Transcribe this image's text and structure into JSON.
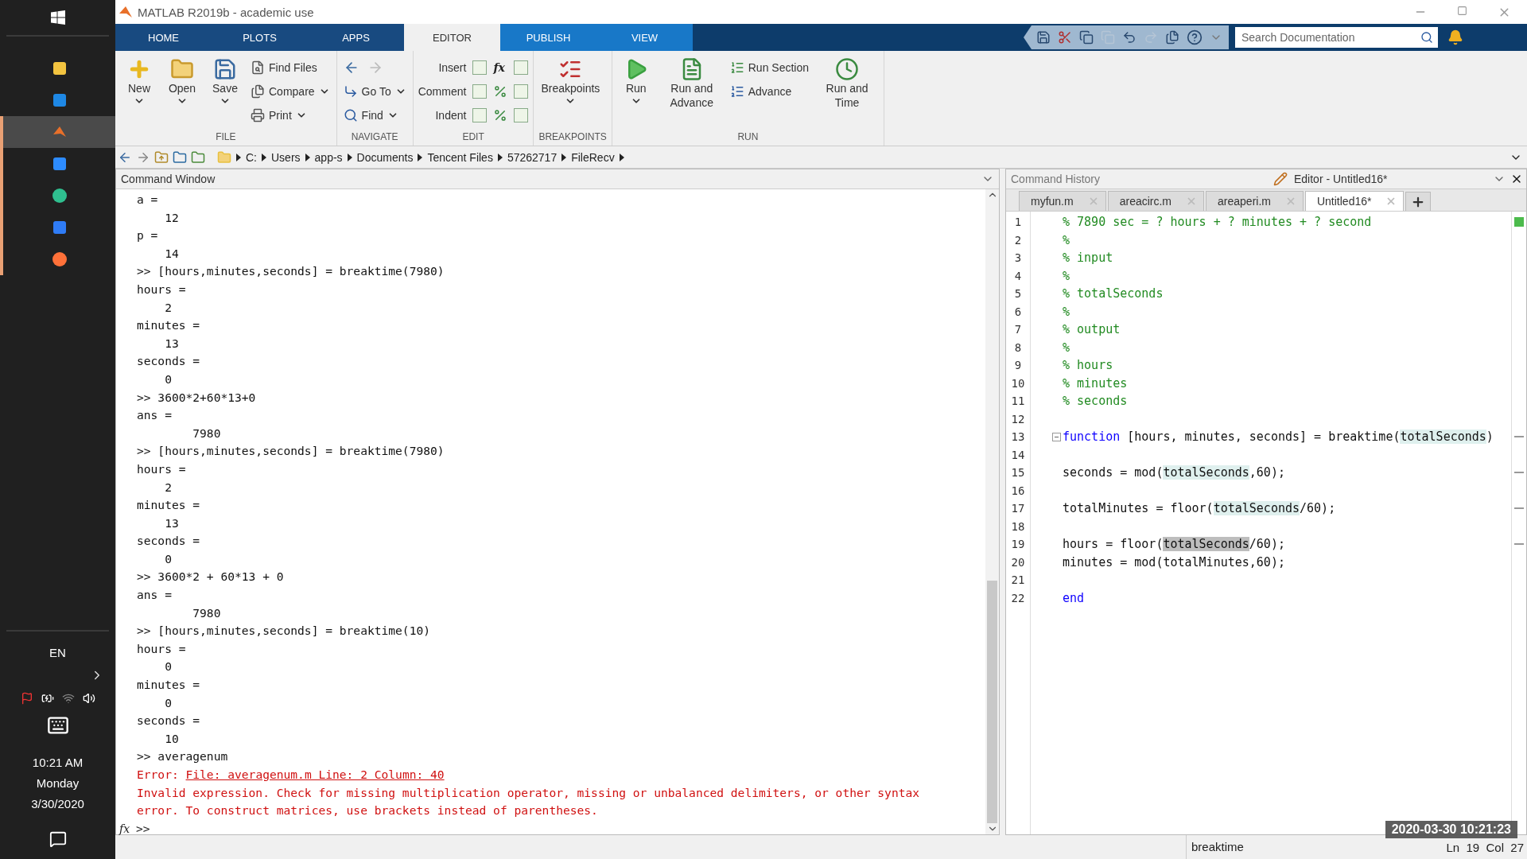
{
  "window": {
    "title": "MATLAB R2019b - academic use"
  },
  "taskbar": {
    "apps": [
      {
        "running": false,
        "selected": false
      },
      {
        "running": false,
        "selected": false
      },
      {
        "running": true,
        "selected": true
      },
      {
        "running": true,
        "selected": false
      },
      {
        "running": true,
        "selected": false
      },
      {
        "running": true,
        "selected": false
      },
      {
        "running": true,
        "selected": false
      }
    ],
    "language": "EN",
    "time": "10:21 AM",
    "day": "Monday",
    "date": "3/30/2020"
  },
  "ribbon_tabs": [
    {
      "label": "HOME",
      "selected": false,
      "kind": "global"
    },
    {
      "label": "PLOTS",
      "selected": false,
      "kind": "global"
    },
    {
      "label": "APPS",
      "selected": false,
      "kind": "global"
    },
    {
      "label": "EDITOR",
      "selected": true,
      "kind": "contextual"
    },
    {
      "label": "PUBLISH",
      "selected": false,
      "kind": "contextual"
    },
    {
      "label": "VIEW",
      "selected": false,
      "kind": "contextual"
    }
  ],
  "search": {
    "placeholder": "Search Documentation"
  },
  "ribbon_groups": [
    {
      "label": "FILE",
      "items": [
        {
          "kind": "big",
          "label": "New",
          "dropdown": true
        },
        {
          "kind": "big",
          "label": "Open",
          "dropdown": true
        },
        {
          "kind": "big",
          "label": "Save",
          "dropdown": true
        },
        {
          "kind": "small",
          "label": "Find Files",
          "dropdown": false
        },
        {
          "kind": "small",
          "label": "Compare",
          "dropdown": true
        },
        {
          "kind": "small",
          "label": "Print",
          "dropdown": true
        }
      ]
    },
    {
      "label": "NAVIGATE",
      "items": [
        {
          "kind": "nav"
        },
        {
          "kind": "small",
          "label": "Go To",
          "dropdown": true
        },
        {
          "kind": "small",
          "label": "Find",
          "dropdown": true
        }
      ]
    },
    {
      "label": "EDIT",
      "items": [
        {
          "kind": "tool_row",
          "label": "Insert",
          "glyph": "fx"
        },
        {
          "kind": "tool_row",
          "label": "Comment"
        },
        {
          "kind": "tool_row",
          "label": "Indent"
        }
      ]
    },
    {
      "label": "BREAKPOINTS",
      "items": [
        {
          "kind": "big",
          "label": "Breakpoints",
          "dropdown": true
        }
      ]
    },
    {
      "label": "RUN",
      "items": [
        {
          "kind": "big",
          "label": "Run",
          "dropdown": true
        },
        {
          "kind": "big",
          "label": "Run and Advance",
          "dropdown": false
        },
        {
          "kind": "small",
          "label": "Run Section",
          "dropdown": false
        },
        {
          "kind": "small",
          "label": "Advance",
          "dropdown": false
        },
        {
          "kind": "big",
          "label": "Run and Time",
          "dropdown": false
        }
      ]
    }
  ],
  "address_path": [
    "C:",
    "Users",
    "app-s",
    "Documents",
    "Tencent Files",
    "57262717",
    "FileRecv"
  ],
  "command_window": {
    "title": "Command Window",
    "lines": [
      {
        "kind": "output",
        "text": "a ="
      },
      {
        "kind": "output",
        "text": "    12"
      },
      {
        "kind": "output",
        "text": "p ="
      },
      {
        "kind": "output",
        "text": "    14"
      },
      {
        "kind": "output",
        "text": ">> [hours,minutes,seconds] = breaktime(7980)"
      },
      {
        "kind": "output",
        "text": "hours ="
      },
      {
        "kind": "output",
        "text": "    2"
      },
      {
        "kind": "output",
        "text": "minutes ="
      },
      {
        "kind": "output",
        "text": "    13"
      },
      {
        "kind": "output",
        "text": "seconds ="
      },
      {
        "kind": "output",
        "text": "    0"
      },
      {
        "kind": "output",
        "text": ">> 3600*2+60*13+0"
      },
      {
        "kind": "output",
        "text": "ans ="
      },
      {
        "kind": "output",
        "text": "        7980"
      },
      {
        "kind": "output",
        "text": ">> [hours,minutes,seconds] = breaktime(7980)"
      },
      {
        "kind": "output",
        "text": "hours ="
      },
      {
        "kind": "output",
        "text": "    2"
      },
      {
        "kind": "output",
        "text": "minutes ="
      },
      {
        "kind": "output",
        "text": "    13"
      },
      {
        "kind": "output",
        "text": "seconds ="
      },
      {
        "kind": "output",
        "text": "    0"
      },
      {
        "kind": "output",
        "text": ">> 3600*2 + 60*13 + 0"
      },
      {
        "kind": "output",
        "text": "ans ="
      },
      {
        "kind": "output",
        "text": "        7980"
      },
      {
        "kind": "output",
        "text": ">> [hours,minutes,seconds] = breaktime(10)"
      },
      {
        "kind": "output",
        "text": "hours ="
      },
      {
        "kind": "output",
        "text": "    0"
      },
      {
        "kind": "output",
        "text": "minutes ="
      },
      {
        "kind": "output",
        "text": "    0"
      },
      {
        "kind": "output",
        "text": "seconds ="
      },
      {
        "kind": "output",
        "text": "    10"
      },
      {
        "kind": "output",
        "text": ">> averagenum"
      },
      {
        "kind": "error_link",
        "text": "Error: ",
        "link": "File: averagenum.m Line: 2 Column: 40"
      },
      {
        "kind": "error",
        "text": "Invalid expression. Check for missing multiplication operator, missing or unbalanced delimiters, or other syntax"
      },
      {
        "kind": "error",
        "text": "error. To construct matrices, use brackets instead of parentheses."
      }
    ],
    "prompt_icon": "fx",
    "prompt": ">>"
  },
  "command_history": {
    "title": "Command History"
  },
  "editor": {
    "title": "Editor - Untitled16*",
    "tabs": [
      {
        "label": "myfun.m",
        "selected": false
      },
      {
        "label": "areacirc.m",
        "selected": false
      },
      {
        "label": "areaperi.m",
        "selected": false
      },
      {
        "label": "Untitled16*",
        "selected": true
      }
    ],
    "lines": [
      {
        "number": "1",
        "segments": [
          {
            "kind": "comment",
            "text": "% 7890 sec = ? hours + ? minutes + ? second"
          }
        ]
      },
      {
        "number": "2",
        "segments": [
          {
            "kind": "comment",
            "text": "%"
          }
        ]
      },
      {
        "number": "3",
        "segments": [
          {
            "kind": "comment",
            "text": "% input"
          }
        ]
      },
      {
        "number": "4",
        "segments": [
          {
            "kind": "comment",
            "text": "%"
          }
        ]
      },
      {
        "number": "5",
        "segments": [
          {
            "kind": "comment",
            "text": "% totalSeconds"
          }
        ]
      },
      {
        "number": "6",
        "segments": [
          {
            "kind": "comment",
            "text": "%"
          }
        ]
      },
      {
        "number": "7",
        "segments": [
          {
            "kind": "comment",
            "text": "% output"
          }
        ]
      },
      {
        "number": "8",
        "segments": [
          {
            "kind": "comment",
            "text": "%"
          }
        ]
      },
      {
        "number": "9",
        "segments": [
          {
            "kind": "comment",
            "text": "% hours"
          }
        ]
      },
      {
        "number": "10",
        "segments": [
          {
            "kind": "comment",
            "text": "% minutes"
          }
        ]
      },
      {
        "number": "11",
        "segments": [
          {
            "kind": "comment",
            "text": "% seconds"
          }
        ]
      },
      {
        "number": "12"
      },
      {
        "number": "13",
        "fold": true,
        "segments": [
          {
            "kind": "keyword",
            "text": "function"
          },
          {
            "kind": "plain",
            "text": " [hours, minutes, seconds] = breaktime("
          },
          {
            "kind": "variable",
            "text": "totalSeconds"
          },
          {
            "kind": "plain",
            "text": ")"
          }
        ]
      },
      {
        "number": "14"
      },
      {
        "number": "15",
        "segments": [
          {
            "kind": "plain",
            "text": "seconds = mod("
          },
          {
            "kind": "variable",
            "text": "totalSeconds"
          },
          {
            "kind": "plain",
            "text": ",60);"
          }
        ]
      },
      {
        "number": "16"
      },
      {
        "number": "17",
        "segments": [
          {
            "kind": "plain",
            "text": "totalMinutes = floor("
          },
          {
            "kind": "variable",
            "text": "totalSeconds"
          },
          {
            "kind": "plain",
            "text": "/60);"
          }
        ]
      },
      {
        "number": "18"
      },
      {
        "number": "19",
        "segments": [
          {
            "kind": "plain",
            "text": "hours = floor("
          },
          {
            "kind": "selected",
            "text": "totalSeconds"
          },
          {
            "kind": "plain",
            "text": "/60);"
          }
        ]
      },
      {
        "number": "20",
        "segments": [
          {
            "kind": "plain",
            "text": "minutes = mod(totalMinutes,60);"
          }
        ]
      },
      {
        "number": "21"
      },
      {
        "number": "22",
        "segments": [
          {
            "kind": "keyword",
            "text": "end"
          }
        ]
      }
    ]
  },
  "status_bar": {
    "function": "breaktime",
    "position": "Ln  19  Col  27"
  },
  "recording_timestamp": "2020-03-30 10:21:23"
}
